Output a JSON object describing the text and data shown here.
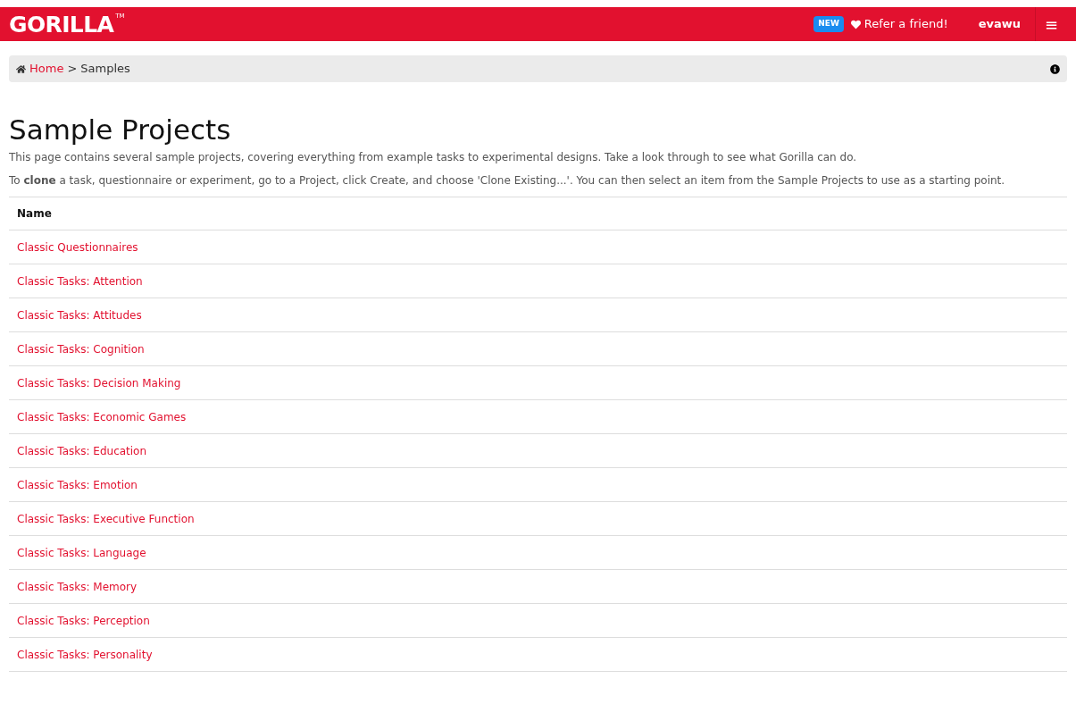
{
  "navbar": {
    "logo": "GORILLA",
    "trademark": "TM",
    "badge": "NEW",
    "refer_link": "Refer a friend!",
    "username": "evawu",
    "menu_glyph": "≡"
  },
  "breadcrumb": {
    "home": "Home",
    "separator": ">",
    "current": "Samples"
  },
  "title": "Sample Projects",
  "intro": [
    "This page contains several sample projects, covering everything from example tasks to experimental designs. Take a look through to see what Gorilla can do.",
    "To **clone** a task, questionnaire or experiment, go to a Project, click Create, and choose 'Clone Existing...'. You can then select an item from the Sample Projects to use as a starting point."
  ],
  "table": {
    "columns": [
      "Name"
    ],
    "rows": [
      "Classic Questionnaires",
      "Classic Tasks: Attention",
      "Classic Tasks: Attitudes",
      "Classic Tasks: Cognition",
      "Classic Tasks: Decision Making",
      "Classic Tasks: Economic Games",
      "Classic Tasks: Education",
      "Classic Tasks: Emotion",
      "Classic Tasks: Executive Function",
      "Classic Tasks: Language",
      "Classic Tasks: Memory",
      "Classic Tasks: Perception",
      "Classic Tasks: Personality"
    ]
  }
}
